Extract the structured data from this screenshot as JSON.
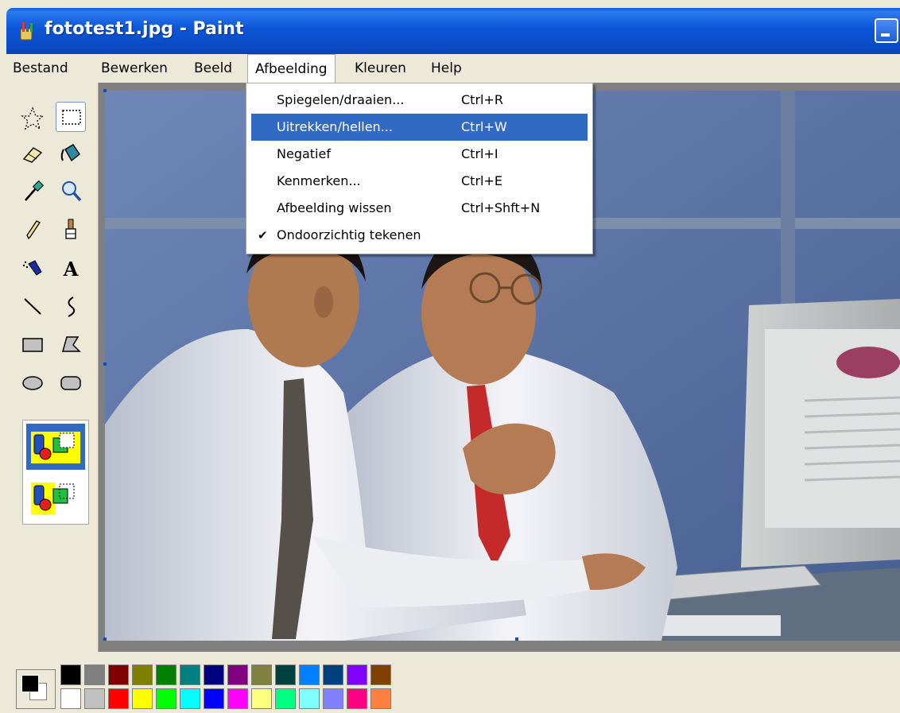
{
  "window": {
    "title": "fototest1.jpg - Paint"
  },
  "menubar": {
    "items": [
      {
        "label": "Bestand"
      },
      {
        "label": "Bewerken"
      },
      {
        "label": "Beeld"
      },
      {
        "label": "Afbeelding"
      },
      {
        "label": "Kleuren"
      },
      {
        "label": "Help"
      }
    ],
    "open_menu": "Afbeelding"
  },
  "dropdown": {
    "items": [
      {
        "label": "Spiegelen/draaien...",
        "shortcut": "Ctrl+R",
        "highlighted": false,
        "checked": false
      },
      {
        "label": "Uitrekken/hellen...",
        "shortcut": "Ctrl+W",
        "highlighted": true,
        "checked": false
      },
      {
        "label": "Negatief",
        "shortcut": "Ctrl+I",
        "highlighted": false,
        "checked": false
      },
      {
        "label": "Kenmerken...",
        "shortcut": "Ctrl+E",
        "highlighted": false,
        "checked": false
      },
      {
        "label": "Afbeelding wissen",
        "shortcut": "Ctrl+Shft+N",
        "highlighted": false,
        "checked": false
      },
      {
        "label": "Ondoorzichtig tekenen",
        "shortcut": "",
        "highlighted": false,
        "checked": true
      }
    ],
    "check_glyph": "✔"
  },
  "toolbox": {
    "tools": [
      {
        "name": "free-form-select-icon",
        "selected": false
      },
      {
        "name": "rect-select-icon",
        "selected": true
      },
      {
        "name": "eraser-icon",
        "selected": false
      },
      {
        "name": "fill-icon",
        "selected": false
      },
      {
        "name": "pick-color-icon",
        "selected": false
      },
      {
        "name": "magnifier-icon",
        "selected": false
      },
      {
        "name": "pencil-icon",
        "selected": false
      },
      {
        "name": "brush-icon",
        "selected": false
      },
      {
        "name": "airbrush-icon",
        "selected": false
      },
      {
        "name": "text-icon",
        "selected": false
      },
      {
        "name": "line-icon",
        "selected": false
      },
      {
        "name": "curve-icon",
        "selected": false
      },
      {
        "name": "rectangle-icon",
        "selected": false
      },
      {
        "name": "polygon-icon",
        "selected": false
      },
      {
        "name": "ellipse-icon",
        "selected": false
      },
      {
        "name": "rounded-rect-icon",
        "selected": false
      }
    ],
    "text_tool_glyph": "A",
    "options": [
      {
        "name": "opaque-option-icon",
        "selected": true
      },
      {
        "name": "transparent-option-icon",
        "selected": false
      }
    ]
  },
  "colors": {
    "foreground": "#000000",
    "background": "#ffffff",
    "palette_top": [
      "#000000",
      "#808080",
      "#800000",
      "#808000",
      "#008000",
      "#008080",
      "#000080",
      "#800080",
      "#808040",
      "#004040",
      "#0080ff",
      "#004080",
      "#8000ff",
      "#804000"
    ],
    "palette_bottom": [
      "#ffffff",
      "#c0c0c0",
      "#ff0000",
      "#ffff00",
      "#00ff00",
      "#00ffff",
      "#0000ff",
      "#ff00ff",
      "#ffff80",
      "#00ff80",
      "#80ffff",
      "#8080ff",
      "#ff0080",
      "#ff8040"
    ]
  },
  "canvas": {
    "image": "photo-two-men-at-computer"
  }
}
